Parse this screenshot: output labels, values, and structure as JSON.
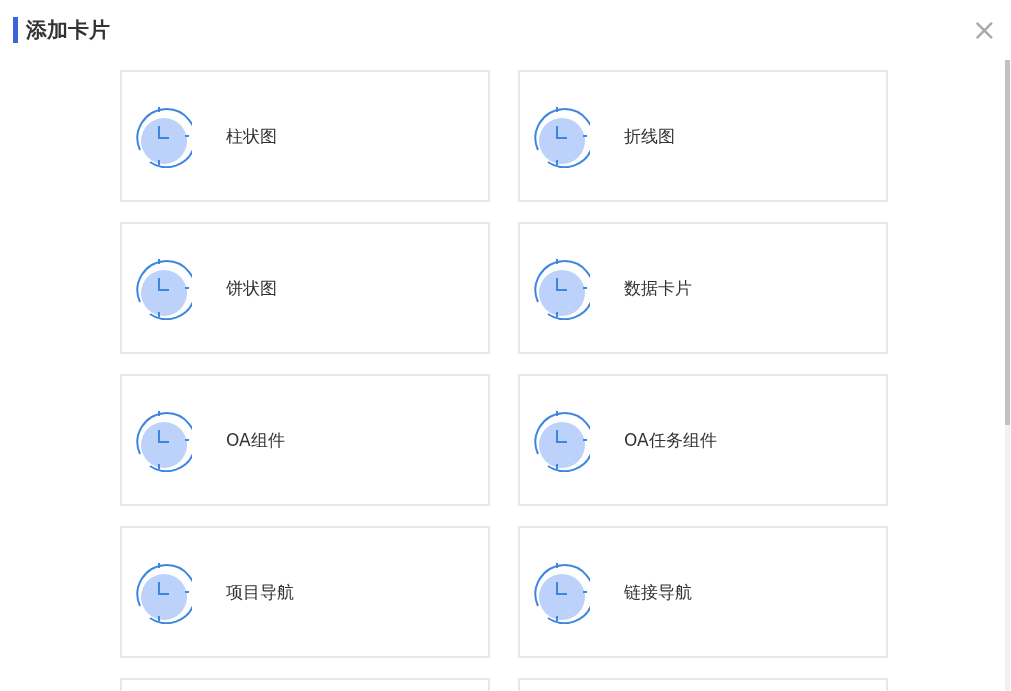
{
  "dialog": {
    "title": "添加卡片",
    "close": "×"
  },
  "cards": [
    {
      "label": "柱状图"
    },
    {
      "label": "折线图"
    },
    {
      "label": "饼状图"
    },
    {
      "label": "数据卡片"
    },
    {
      "label": "OA组件"
    },
    {
      "label": "OA任务组件"
    },
    {
      "label": "项目导航"
    },
    {
      "label": "链接导航"
    }
  ]
}
